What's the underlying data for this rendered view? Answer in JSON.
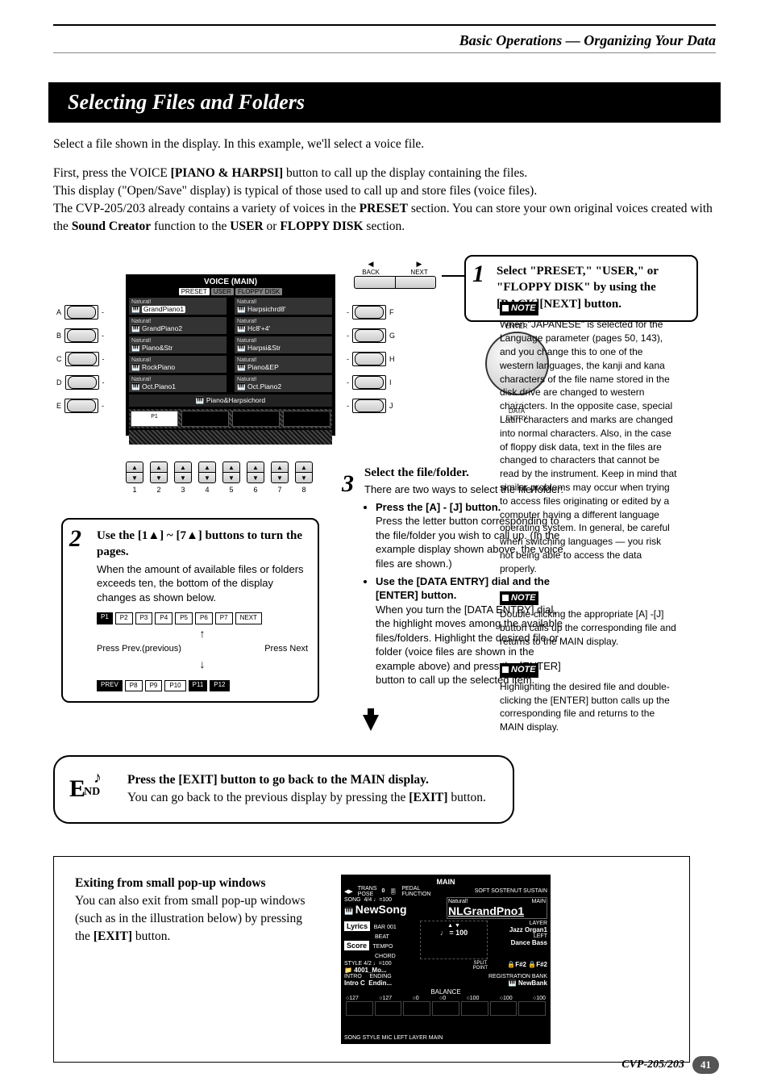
{
  "header": {
    "chapter": "Basic Operations — Organizing Your Data"
  },
  "section_title": "Selecting Files and Folders",
  "intro": {
    "p1": "Select a file shown in the display. In this example, we'll select a voice file.",
    "p2a": "First, press the VOICE ",
    "p2b": "[PIANO & HARPSI]",
    "p2c": " button to call up the display containing the files.",
    "p3": "This display (\"Open/Save\" display) is typical of those used to call up and store files (voice files).",
    "p4a": "The CVP-205/203 already contains a variety of voices in the ",
    "p4b": "PRESET",
    "p4c": " section. You can store your own original voices created with the ",
    "p4d": "Sound Creator",
    "p4e": " function to the ",
    "p4f": "USER",
    "p4g": " or ",
    "p4h": "FLOPPY DISK",
    "p4i": " section."
  },
  "lcd": {
    "title": "VOICE (MAIN)",
    "tab_preset": "PRESET",
    "tab_user": "USER",
    "tab_fd": "FLOPPY DISK",
    "rows": [
      {
        "l_sub": "Natural!",
        "l": "GrandPiano1",
        "r_sub": "Natural!",
        "r": "Harpsichrd8'"
      },
      {
        "l_sub": "Natural!",
        "l": "GrandPiano2",
        "r_sub": "Natural!",
        "r": "Hc8'+4'"
      },
      {
        "l_sub": "Natural!",
        "l": "Piano&Str",
        "r_sub": "Natural!",
        "r": "Harpsi&Str"
      },
      {
        "l_sub": "Natural!",
        "l": "RockPiano",
        "r_sub": "Natural!",
        "r": "Piano&EP"
      },
      {
        "l_sub": "Natural!",
        "l": "Oct.Piano1",
        "r_sub": "Natural!",
        "r": "Oct.Piano2"
      }
    ],
    "category": "Piano&Harpsichord",
    "p1": "P1"
  },
  "buttons": {
    "left": [
      "A",
      "B",
      "C",
      "D",
      "E"
    ],
    "right": [
      "F",
      "G",
      "H",
      "I",
      "J"
    ],
    "back": "BACK",
    "next": "NEXT",
    "enter": "ENTER",
    "data_entry": "DATA\nENTRY",
    "numbers": [
      "1",
      "2",
      "3",
      "4",
      "5",
      "6",
      "7",
      "8"
    ]
  },
  "step1": {
    "num": "1",
    "text_a": "Select \"PRESET,\" \"USER,\" or \"FLOPPY DISK\" by using the [BACK][NEXT] button."
  },
  "step2": {
    "num": "2",
    "head": "Use the [1▲] ~ [7▲] buttons to turn the pages.",
    "body": "When the amount of available files or folders exceeds ten, the bottom of the display changes as shown below.",
    "bar1": [
      "P1",
      "P2",
      "P3",
      "P4",
      "P5",
      "P6",
      "P7",
      "NEXT"
    ],
    "prev": "Press Prev.(previous)",
    "next": "Press Next",
    "bar2": [
      "PREV",
      "P8",
      "P9",
      "P10",
      "P11",
      "P12"
    ]
  },
  "step3": {
    "num": "3",
    "head": "Select the file/folder.",
    "intro": "There are two ways to select the file/folder:",
    "li1_t": "Press the [A] - [J] button.",
    "li1_b": "Press the letter button corresponding to the file/folder you wish to call up. (In the example display shown above, the voice files are shown.)",
    "li2_t": "Use the [DATA ENTRY] dial and the [ENTER] button.",
    "li2_b": "When you turn the [DATA ENTRY] dial, the highlight moves among the available files/folders. Highlight the desired file or folder (voice files are shown in the example above) and press the [ENTER] button to call up the selected item."
  },
  "end": {
    "line1_a": "Press the [EXIT] button to go back to the MAIN display.",
    "line2_a": "You can go back to the previous display by pressing the ",
    "line2_b": "[EXIT]",
    "line2_c": " button."
  },
  "notes": {
    "label": "NOTE",
    "n1": "When \"JAPANESE\" is selected for the Language parameter (pages 50, 143), and you change this to one of the western languages, the kanji and kana characters of the file name stored in the disk drive are changed to western characters. In the opposite case, special Latin characters and marks are changed into normal characters. Also, in the case of floppy disk data, text in the files are changed to characters that cannot be read by the instrument. Keep in mind that similar problems may occur when trying to access files originating or edited by a computer having a different language operating system. In general, be careful when switching languages — you risk not being able to access the data properly.",
    "n2": "Double-clicking the appropriate [A] -[J] button calls up the corresponding file and returns to the MAIN display.",
    "n3": "Highlighting the desired file and double-clicking the [ENTER] button calls up the corresponding file and returns to the MAIN display."
  },
  "popup": {
    "head": "Exiting from small pop-up windows",
    "body_a": "You can also exit from small pop-up windows (such as in the illustration below) by pressing the ",
    "body_b": "[EXIT]",
    "body_c": " button."
  },
  "main_shot": {
    "title": "MAIN",
    "trans": "TRANS\nPOSE",
    "zero": "0",
    "pedal": "PEDAL\nFUNCTION",
    "soft": "SOFT SOSTENUT SUSTAIN",
    "song_label": "SONG",
    "time_sig": "4/4",
    "tempo_v": "♩=100",
    "song": "NewSong",
    "natural": "Natural!",
    "mainv": "MAIN",
    "voice": "NLGrandPno1",
    "lyrics": "Lyrics",
    "score": "Score",
    "bar": "BAR",
    "bar_n": "001",
    "beat": "BEAT",
    "tempo": "TEMPO",
    "chord": "CHORD",
    "tempo_eq": "♩ = 100",
    "layer": "LAYER",
    "jazz": "Jazz Organ1",
    "left_l": "LEFT",
    "dance": "Dance Bass",
    "style_l": "STYLE",
    "style_ts": "4/2",
    "style_tm": "♩=100",
    "style": "4001_Mo...",
    "split": "SPLIT\nPOINT",
    "f2a": "F#2",
    "f2b": "F#2",
    "intro_l": "INTRO",
    "ending_l": "ENDING",
    "intro": "Intro C",
    "ending": "Endin...",
    "reg_l": "REGISTRATION BANK",
    "bank": "NewBank",
    "balance": "BALANCE",
    "b127a": "127",
    "b127b": "127",
    "b0a": "0",
    "b0b": "0",
    "b100a": "100",
    "b100b": "100",
    "b100c": "100",
    "bal_labels": "SONG    STYLE                      MIC                     LEFT    LAYER    MAIN"
  },
  "footer": {
    "model": "CVP-205/203",
    "page": "41"
  }
}
